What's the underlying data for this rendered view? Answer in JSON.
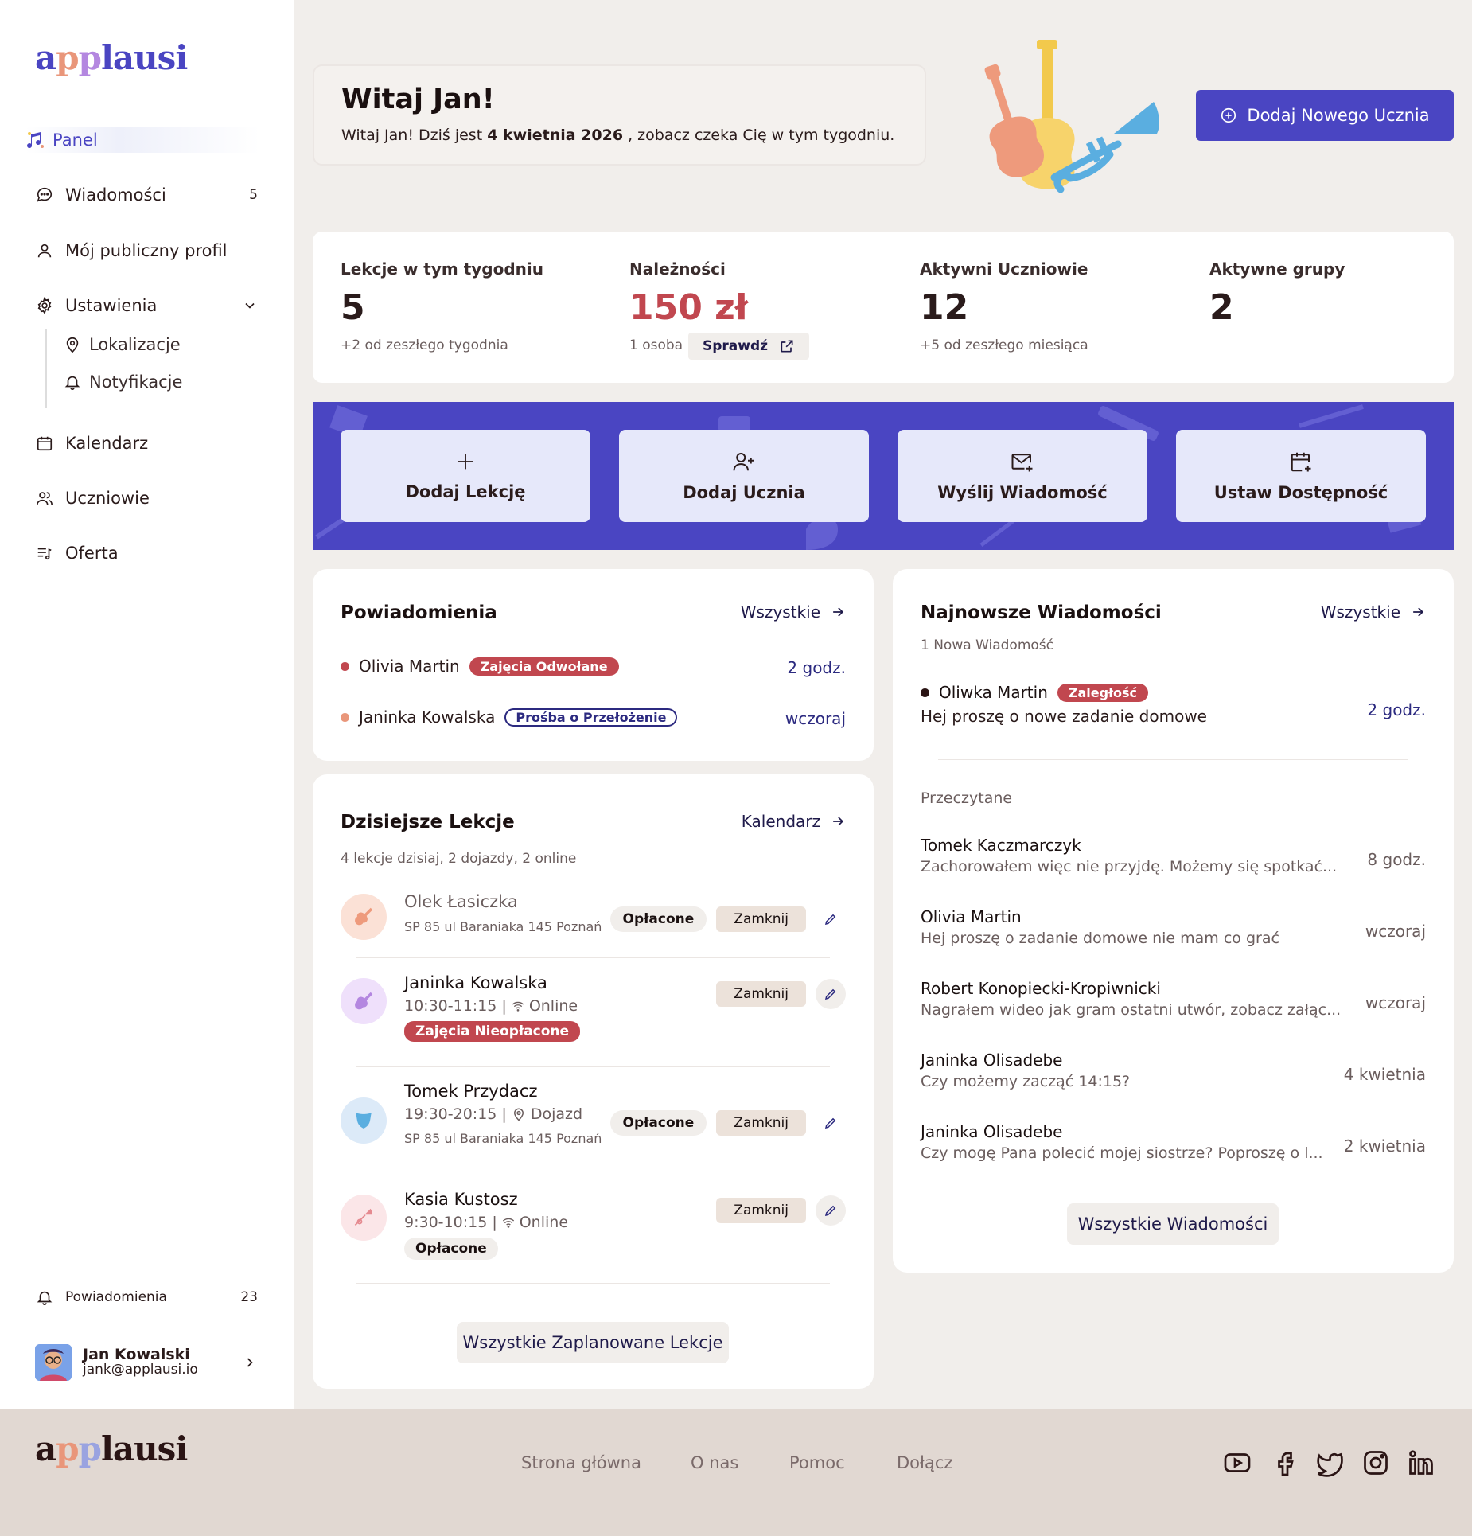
{
  "brand": {
    "logo_a": "a",
    "logo_o": "p",
    "logo_p": "p",
    "logo_rest": "lausi"
  },
  "sidebar": {
    "panel": "Panel",
    "items": [
      {
        "label": "Wiadomości",
        "count": "5",
        "icon": "message-icon"
      },
      {
        "label": "Mój publiczny profil",
        "icon": "user-icon"
      },
      {
        "label": "Ustawienia",
        "icon": "gear-icon"
      },
      {
        "label": "Kalendarz",
        "icon": "calendar-icon"
      },
      {
        "label": "Uczniowie",
        "icon": "users-icon"
      },
      {
        "label": "Oferta",
        "icon": "music-list-icon"
      }
    ],
    "sub_items": [
      {
        "label": "Lokalizacje",
        "icon": "location-pin-icon"
      },
      {
        "label": "Notyfikacje",
        "icon": "bell-icon"
      }
    ],
    "notifications": {
      "label": "Powiadomienia",
      "count": "23"
    },
    "user": {
      "name": "Jan Kowalski",
      "email": "jank@applausi.io"
    }
  },
  "welcome": {
    "title": "Witaj Jan!",
    "text_before": "Witaj Jan! Dziś jest ",
    "date": "4 kwietnia 2026",
    "text_after": " , zobacz czeka Cię w tym tygodniu."
  },
  "add_student_button": "Dodaj Nowego Ucznia",
  "stats": [
    {
      "label": "Lekcje w tym tygodniu",
      "value": "5",
      "sub": "+2  od zeszłego tygodnia"
    },
    {
      "label": "Należności",
      "value": "150 zł",
      "sub": "1 osoba",
      "action": "Sprawdź"
    },
    {
      "label": "Aktywni Uczniowie",
      "value": "12",
      "sub": "+5  od zeszłego miesiąca"
    },
    {
      "label": "Aktywne grupy",
      "value": "2"
    }
  ],
  "quick_actions": [
    {
      "label": "Dodaj Lekcję",
      "icon": "plus-icon"
    },
    {
      "label": "Dodaj Ucznia",
      "icon": "user-plus-icon"
    },
    {
      "label": "Wyślij Wiadomość",
      "icon": "mail-plus-icon"
    },
    {
      "label": "Ustaw Dostępność",
      "icon": "calendar-plus-icon"
    }
  ],
  "notifications_card": {
    "title": "Powiadomienia",
    "link": "Wszystkie",
    "items": [
      {
        "name": "Olivia Martin",
        "tag": "Zajęcia Odwołane",
        "time": "2 godz.",
        "dot": "#c1474f"
      },
      {
        "name": "Janinka Kowalska",
        "tag": "Prośba o Przełożenie",
        "time": "wczoraj",
        "dot": "#e9967a"
      }
    ]
  },
  "lessons_card": {
    "title": "Dzisiejsze Lekcje",
    "link": "Kalendarz",
    "subtitle": "4 lekcje dzisiaj, 2 dojazdy, 2 online",
    "paid": "Opłacone",
    "close": "Zamknij",
    "unpaid": "Zajęcia Nieopłacone",
    "items": [
      {
        "name": "Olek Łasiczka",
        "address": "SP 85 ul Baraniaka 145 Poznań"
      },
      {
        "name": "Janinka Kowalska",
        "time": "10:30-11:15 |",
        "mode": "Online"
      },
      {
        "name": "Tomek Przydacz",
        "time": "19:30-20:15 |",
        "mode": "Dojazd",
        "address": "SP 85 ul Baraniaka 145 Poznań"
      },
      {
        "name": "Kasia Kustosz",
        "time": "9:30-10:15 |",
        "mode": "Online"
      }
    ],
    "all_button": "Wszystkie Zaplanowane Lekcje"
  },
  "messages_card": {
    "title": "Najnowsze Wiadomości",
    "link": "Wszystkie",
    "new_count": "1 Nowa Wiadomość",
    "new_item": {
      "name": "Oliwka Martin",
      "tag": "Zaległość",
      "text": "Hej proszę o nowe zadanie domowe",
      "time": "2 godz."
    },
    "read_label": "Przeczytane",
    "read_items": [
      {
        "name": "Tomek Kaczmarczyk",
        "text": "Zachorowałem więc nie przyjdę. Możemy się spotkać...",
        "time": "8 godz."
      },
      {
        "name": "Olivia Martin",
        "text": "Hej proszę o zadanie domowe nie mam co grać",
        "time": "wczoraj"
      },
      {
        "name": "Robert Konopiecki-Kropiwnicki",
        "text": "Nagrałem wideo jak gram ostatni utwór, zobacz załąc...",
        "time": "wczoraj"
      },
      {
        "name": "Janinka Olisadebe",
        "text": "Czy możemy zacząć 14:15?",
        "time": "4 kwietnia"
      },
      {
        "name": "Janinka Olisadebe",
        "text": "Czy mogę Pana polecić mojej siostrze? Poproszę o l...",
        "time": "2 kwietnia"
      }
    ],
    "all_button": "Wszystkie Wiadomości"
  },
  "footer": {
    "links": [
      "Strona główna",
      "O nas",
      "Pomoc",
      "Dołącz"
    ],
    "social": [
      "youtube-icon",
      "facebook-icon",
      "twitter-icon",
      "instagram-icon",
      "linkedin-icon"
    ]
  },
  "colors": {
    "accent": "#4a45c2",
    "danger": "#c1474f",
    "background": "#f1eeeb",
    "footer": "#e1d8d2"
  }
}
